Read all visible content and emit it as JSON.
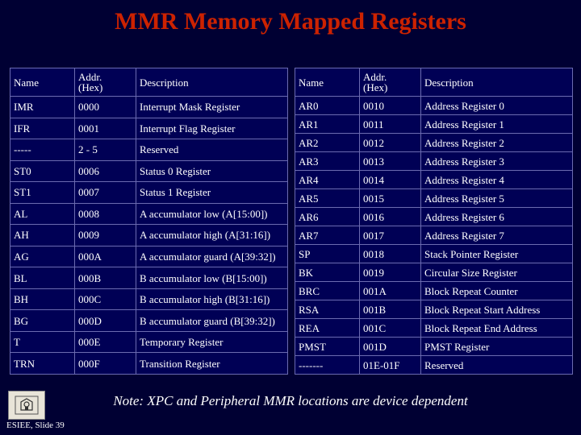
{
  "slide": {
    "title": "MMR Memory Mapped Registers",
    "note": "Note: XPC and Peripheral MMR locations are device dependent",
    "slide_label": "ESIEE, Slide 39",
    "logo_icon": "esiee-logo-icon",
    "accent_title_color": "#cc2200",
    "background_color": "#000033",
    "table_background_color": "#000055",
    "table_border_color": "#6b6bb0"
  },
  "tables": {
    "headers": [
      "Name",
      "Addr. (Hex)",
      "Description"
    ],
    "header_lines": {
      "name": "Name",
      "addr_line1": "Addr.",
      "addr_line2": "(Hex)",
      "description": "Description"
    },
    "left": [
      {
        "name": "IMR",
        "addr": "0000",
        "desc": "Interrupt Mask Register"
      },
      {
        "name": "IFR",
        "addr": "0001",
        "desc": "Interrupt Flag Register"
      },
      {
        "name": "-----",
        "addr": "2 - 5",
        "desc": "Reserved"
      },
      {
        "name": "ST0",
        "addr": "0006",
        "desc": "Status 0 Register"
      },
      {
        "name": "ST1",
        "addr": "0007",
        "desc": "Status 1 Register"
      },
      {
        "name": "AL",
        "addr": "0008",
        "desc": "A accumulator low (A[15:00])"
      },
      {
        "name": "AH",
        "addr": "0009",
        "desc": "A accumulator high (A[31:16])"
      },
      {
        "name": "AG",
        "addr": "000A",
        "desc": "A accumulator guard (A[39:32])"
      },
      {
        "name": "BL",
        "addr": "000B",
        "desc": "B accumulator low (B[15:00])"
      },
      {
        "name": "BH",
        "addr": "000C",
        "desc": "B accumulator high (B[31:16])"
      },
      {
        "name": "BG",
        "addr": "000D",
        "desc": "B accumulator guard (B[39:32])"
      },
      {
        "name": "T",
        "addr": "000E",
        "desc": "Temporary Register"
      },
      {
        "name": "TRN",
        "addr": "000F",
        "desc": "Transition Register"
      }
    ],
    "right": [
      {
        "name": "AR0",
        "addr": "0010",
        "desc": "Address Register 0"
      },
      {
        "name": "AR1",
        "addr": "0011",
        "desc": "Address Register 1"
      },
      {
        "name": "AR2",
        "addr": "0012",
        "desc": "Address Register 2"
      },
      {
        "name": "AR3",
        "addr": "0013",
        "desc": "Address Register 3"
      },
      {
        "name": "AR4",
        "addr": "0014",
        "desc": "Address Register 4"
      },
      {
        "name": "AR5",
        "addr": "0015",
        "desc": "Address Register 5"
      },
      {
        "name": "AR6",
        "addr": "0016",
        "desc": "Address Register 6"
      },
      {
        "name": "AR7",
        "addr": "0017",
        "desc": "Address Register 7"
      },
      {
        "name": "SP",
        "addr": "0018",
        "desc": "Stack Pointer Register"
      },
      {
        "name": "BK",
        "addr": "0019",
        "desc": "Circular Size Register"
      },
      {
        "name": "BRC",
        "addr": "001A",
        "desc": "Block Repeat Counter"
      },
      {
        "name": "RSA",
        "addr": "001B",
        "desc": "Block Repeat Start Address"
      },
      {
        "name": "REA",
        "addr": "001C",
        "desc": "Block Repeat End Address"
      },
      {
        "name": "PMST",
        "addr": "001D",
        "desc": "PMST Register"
      },
      {
        "name": "-------",
        "addr": "01E-01F",
        "desc": "Reserved"
      }
    ]
  }
}
